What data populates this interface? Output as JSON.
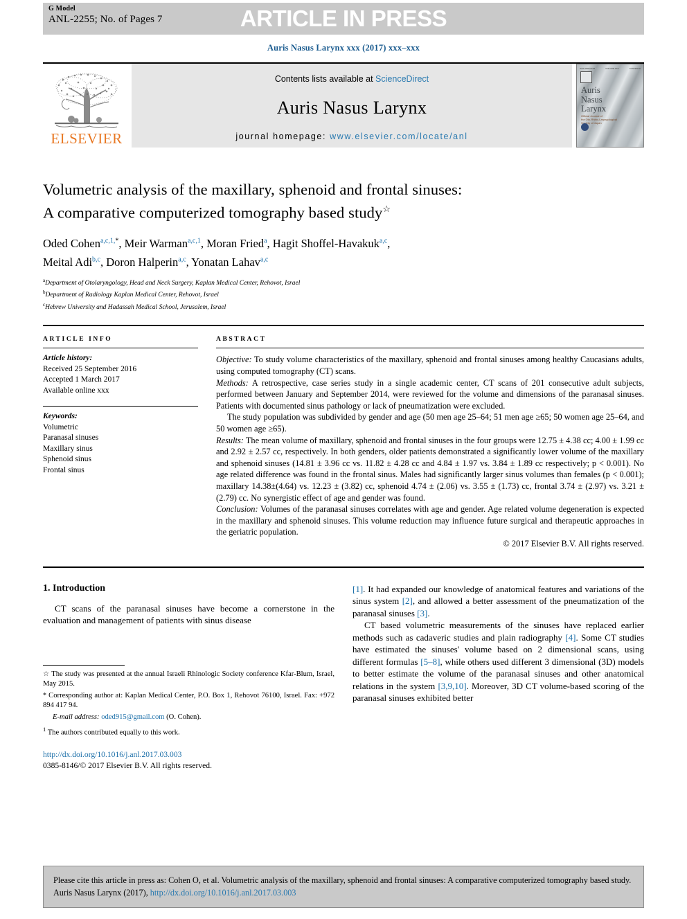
{
  "banner": {
    "model_label": "G Model",
    "article_id": "ANL-2255; No. of Pages 7",
    "in_press": "ARTICLE IN PRESS"
  },
  "journal_citation_line": "Auris Nasus Larynx xxx (2017) xxx–xxx",
  "masthead": {
    "publisher": "ELSEVIER",
    "contents_prefix": "Contents lists available at ",
    "contents_link": "ScienceDirect",
    "journal_title": "Auris Nasus Larynx",
    "homepage_prefix": "journal homepage: ",
    "homepage_url": "www.elsevier.com/locate/anl",
    "cover": {
      "title_lines": [
        "Auris",
        "Nasus",
        "Larynx"
      ],
      "subtitle_lines": [
        "Official Journal of",
        "the Oto-Rhino-Laryngological",
        "Society of Japan"
      ],
      "head_left": "ISSN 0385-8146",
      "head_mid": "VOLUME XXX",
      "head_right": "CONTENTS"
    }
  },
  "article": {
    "title_line1": "Volumetric analysis of the maxillary, sphenoid and frontal sinuses:",
    "title_line2": "A comparative computerized tomography based study",
    "title_footnote_mark": "☆",
    "authors": [
      {
        "name": "Oded Cohen",
        "marks": "a,c,1,",
        "star": "*",
        "sep": ", "
      },
      {
        "name": "Meir Warman",
        "marks": "a,c,1",
        "star": "",
        "sep": ", "
      },
      {
        "name": "Moran Fried",
        "marks": "a",
        "star": "",
        "sep": ", "
      },
      {
        "name": "Hagit Shoffel-Havakuk",
        "marks": "a,c",
        "star": "",
        "sep": ","
      },
      {
        "name": "Meital Adi",
        "marks": "b,c",
        "star": "",
        "sep": ", "
      },
      {
        "name": "Doron Halperin",
        "marks": "a,c",
        "star": "",
        "sep": ", "
      },
      {
        "name": "Yonatan Lahav",
        "marks": "a,c",
        "star": "",
        "sep": ""
      }
    ],
    "affiliations": [
      {
        "mark": "a",
        "text": "Department of Otolaryngology, Head and Neck Surgery, Kaplan Medical Center, Rehovot, Israel"
      },
      {
        "mark": "b",
        "text": "Department of Radiology Kaplan Medical Center, Rehovot, Israel"
      },
      {
        "mark": "c",
        "text": "Hebrew University and Hadassah Medical School, Jerusalem, Israel"
      }
    ]
  },
  "article_info": {
    "label": "ARTICLE INFO",
    "history_label": "Article history:",
    "history": [
      "Received 25 September 2016",
      "Accepted 1 March 2017",
      "Available online xxx"
    ],
    "keywords_label": "Keywords:",
    "keywords": [
      "Volumetric",
      "Paranasal sinuses",
      "Maxillary sinus",
      "Sphenoid sinus",
      "Frontal sinus"
    ]
  },
  "abstract": {
    "label": "ABSTRACT",
    "objective_label": "Objective:",
    "objective_text": " To study volume characteristics of the maxillary, sphenoid and frontal sinuses among healthy Caucasians adults, using computed tomography (CT) scans.",
    "methods_label": "Methods:",
    "methods_text": " A retrospective, case series study in a single academic center, CT scans of 201 consecutive adult subjects, performed between January and September 2014, were reviewed for the volume and dimensions of the paranasal sinuses. Patients with documented sinus pathology or lack of pneumatization were excluded.",
    "methods_para2": "The study population was subdivided by gender and age (50 men age 25–64; 51 men age ≥65; 50 women age 25–64, and 50 women age ≥65).",
    "results_label": "Results:",
    "results_text": " The mean volume of maxillary, sphenoid and frontal sinuses in the four groups were 12.75 ± 4.38 cc; 4.00 ± 1.99 cc and 2.92 ± 2.57 cc, respectively. In both genders, older patients demonstrated a significantly lower volume of the maxillary and sphenoid sinuses (14.81 ± 3.96 cc vs. 11.82 ± 4.28 cc and 4.84 ± 1.97 vs. 3.84 ± 1.89 cc respectively; p < 0.001). No age related difference was found in the frontal sinus. Males had significantly larger sinus volumes than females (p < 0.001); maxillary 14.38±(4.64) vs. 12.23 ± (3.82) cc, sphenoid 4.74 ± (2.06) vs. 3.55 ± (1.73) cc, frontal 3.74 ± (2.97) vs. 3.21 ± (2.79) cc. No synergistic effect of age and gender was found.",
    "conclusion_label": "Conclusion:",
    "conclusion_text": " Volumes of the paranasal sinuses correlates with age and gender. Age related volume degeneration is expected in the maxillary and sphenoid sinuses. This volume reduction may influence future surgical and therapeutic approaches in the geriatric population.",
    "copyright": "© 2017 Elsevier B.V. All rights reserved."
  },
  "introduction": {
    "heading": "1.  Introduction",
    "left_para": "CT scans of the paranasal sinuses have become a cornerstone in the evaluation and management of patients with sinus disease",
    "right_para1_a": ". It had expanded our knowledge of anatomical features and variations of the sinus system ",
    "right_para1_b": ", and allowed a better assessment of the pneumatization of the paranasal sinuses ",
    "right_para1_c": ".",
    "ref1": "[1]",
    "ref2": "[2]",
    "ref3": "[3]",
    "right_para2_a": "CT based volumetric measurements of the sinuses have replaced earlier methods such as cadaveric studies and plain radiography ",
    "ref4": "[4]",
    "right_para2_b": ". Some CT studies have estimated the sinuses' volume based on 2 dimensional scans, using different formulas ",
    "ref58": "[5–8]",
    "right_para2_c": ", while others used different 3 dimensional (3D) models to better estimate the volume of the paranasal sinuses and other anatomical relations in the system ",
    "ref3910": "[3,9,10]",
    "right_para2_d": ". Moreover, 3D CT volume-based scoring of the paranasal sinuses exhibited better"
  },
  "footnotes": {
    "star_symbol": "☆",
    "star_text": " The study was presented at the annual Israeli Rhinologic Society conference Kfar-Blum, Israel, May 2015.",
    "corr_symbol": "*",
    "corr_text": " Corresponding author at: Kaplan Medical Center, P.O. Box 1, Rehovot 76100, Israel. Fax: +972 894 417 94.",
    "email_label": "E-mail address:",
    "email": "oded915@gmail.com",
    "email_suffix": " (O. Cohen).",
    "one_symbol": "1",
    "one_text": " The authors contributed equally to this work.",
    "doi": "http://dx.doi.org/10.1016/j.anl.2017.03.003",
    "issn": "0385-8146/© 2017 Elsevier B.V. All rights reserved."
  },
  "cite_box": {
    "text_a": "Please cite this article in press as: Cohen O, et al. Volumetric analysis of the maxillary, sphenoid and frontal sinuses: A comparative computerized tomography based study. Auris Nasus Larynx (2017), ",
    "doi": "http://dx.doi.org/10.1016/j.anl.2017.03.003"
  },
  "colors": {
    "link_blue": "#2a7ab0",
    "ref_blue": "#1a6ea8",
    "elsevier_orange": "#e87722",
    "banner_gray": "#c9c9c9",
    "masthead_gray": "#e6e6e6"
  }
}
